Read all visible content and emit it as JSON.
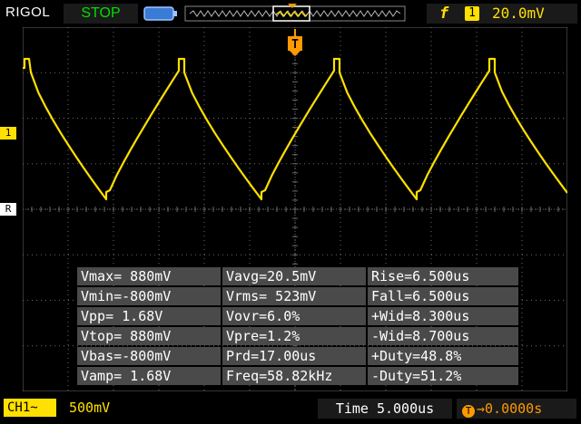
{
  "header": {
    "brand": "RIGOL",
    "run_status": "STOP",
    "trigger_channel": "1",
    "trigger_level": "20.0mV",
    "trigger_marker": "T"
  },
  "markers": {
    "ch1": "1",
    "ref": "R"
  },
  "footer": {
    "channel": "CH1",
    "coupling_symbol": "~",
    "volts_per_div": "500mV",
    "timebase": "Time 5.000us",
    "trigger_offset": "0.0000s"
  },
  "measurements": {
    "rows": [
      [
        "Vmax= 880mV",
        "Vavg=20.5mV",
        "Rise=6.500us"
      ],
      [
        "Vmin=-800mV",
        "Vrms= 523mV",
        "Fall=6.500us"
      ],
      [
        "Vpp= 1.68V",
        "Vovr=6.0%",
        "+Wid=8.300us"
      ],
      [
        "Vtop= 880mV",
        "Vpre=1.2%",
        "-Wid=8.700us"
      ],
      [
        "Vbas=-800mV",
        "Prd=17.00us",
        "+Duty=48.8%"
      ],
      [
        "Vamp= 1.68V",
        "Freq=58.82kHz",
        "-Duty=51.2%"
      ]
    ]
  },
  "colors": {
    "trace": "#ffe000",
    "grid": "#6a6a6a",
    "accent_orange": "#ff9900",
    "status_green": "#00e000"
  },
  "icons": {
    "status_battery": "memory-depth-icon",
    "trigger_slope": "rising-edge-icon"
  }
}
